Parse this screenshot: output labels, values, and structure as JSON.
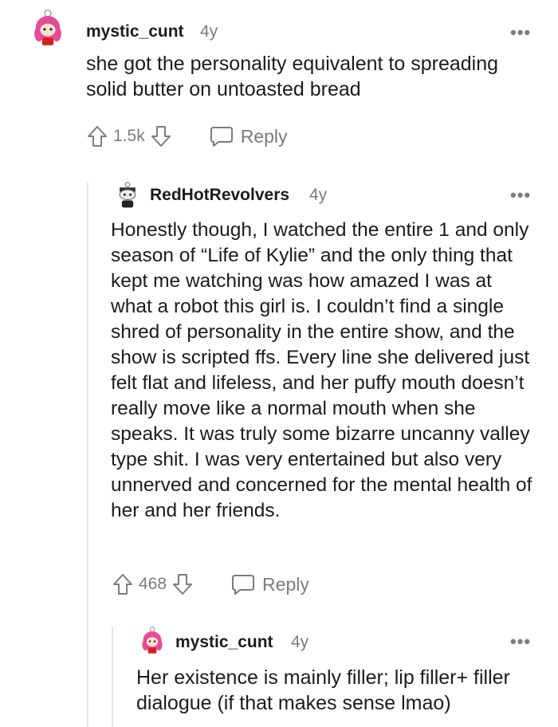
{
  "comments": [
    {
      "username": "mystic_cunt",
      "age": "4y",
      "body": "she got the personality equivalent to spreading solid butter on untoasted bread",
      "votes": "1.5k",
      "reply_label": "Reply",
      "avatar_icon": "pink-hair-avatar-icon"
    },
    {
      "username": "RedHotRevolvers",
      "age": "4y",
      "body": "Honestly though, I watched the entire 1 and only season of “Life of Kylie” and the only thing that kept me watching was how amazed I was at what a robot this girl is. I couldn’t find a single shred of personality in the entire show, and the show is scripted ffs. Every line she delivered just felt flat and lifeless, and her puffy mouth doesn’t really move like a normal mouth when she speaks. It was truly some bizarre uncanny valley type shit. I was very entertained but also very unnerved and concerned for the mental health of her and her friends.",
      "votes": "468",
      "reply_label": "Reply",
      "avatar_icon": "snoo-avatar-icon"
    },
    {
      "username": "mystic_cunt",
      "age": "4y",
      "body": "Her existence is mainly filler; lip filler+ filler dialogue (if that makes sense lmao)",
      "avatar_icon": "pink-hair-avatar-icon"
    }
  ],
  "more_label": "•••",
  "colors": {
    "text": "#1c1c1c",
    "meta": "#7c7c7c",
    "thread_line": "#e5e5e5",
    "avatar_hair": "#e64b9b"
  }
}
